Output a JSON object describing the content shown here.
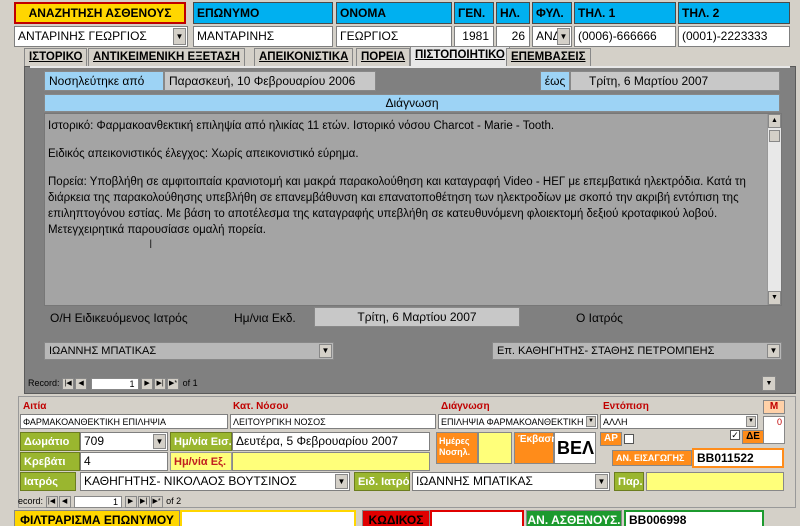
{
  "header": {
    "search_label": "ΑΝΑΖΗΤΗΣΗ ΑΣΘΕΝΟΥΣ",
    "search_value": "ΑΝΤΑΡΙΝΗΣ ΓΕΩΡΓΙΟΣ",
    "col_surname": "ΕΠΩΝΥΜΟ",
    "col_name": "ΟΝΟΜΑ",
    "col_year": "ΓΕΝ.",
    "col_age": "ΗΛ.",
    "col_sex": "ΦΥΛ.",
    "col_tel1": "ΤΗΛ. 1",
    "col_tel2": "ΤΗΛ. 2",
    "surname": "ΜΑΝΤΑΡΙΝΗΣ",
    "name": "ΓΕΩΡΓΙΟΣ",
    "year": "1981",
    "age": "26",
    "sex": "ΑΝΔΙ",
    "tel1": "(0006)-666666",
    "tel2": "(0001)-2223333"
  },
  "tabs": [
    {
      "label": "ΙΣΤΟΡΙΚΟ"
    },
    {
      "label": "ΑΝΤΙΚΕΙΜΕΝΙΚΗ ΕΞΕΤΑΣΗ"
    },
    {
      "label": "ΑΠΕΙΚΟΝΙΣΤΙΚΑ"
    },
    {
      "label": "ΠΟΡΕΙΑ"
    },
    {
      "label": "ΠΙΣΤΟΠΟΙΗΤΙΚΟ"
    },
    {
      "label": "ΕΠΕΜΒΑΣΕΙΣ"
    }
  ],
  "certificate": {
    "admitted_label": "Νοσηλεύτηκε από",
    "admitted_date": "Παρασκευή, 10 Φεβρουαρίου 2006",
    "until_label": "έως",
    "until_date": "Τρίτη, 6 Μαρτίου 2007",
    "diagnosis_title": "Διάγνωση",
    "diagnosis_p1": "Ιστορικό: Φαρμακοανθεκτική επιληψία από ηλικίας 11 ετών. Ιστορικό νόσου Charcot - Marie - Tooth.",
    "diagnosis_p2": "Ειδικός απεικονιστικός έλεγχος: Χωρίς απεικονιστικό εύρημα.",
    "diagnosis_p3": "Πορεία: Υποβλήθη σε αμφιτοιπαία κρανιοτομή και μακρά παρακολούθηση και καταγραφή Video - ΗΕΓ με επεμβατικά ηλεκτρόδια. Κατά τη διάρκεια της παρακολούθησης υπεβλήθη σε επανεμβάθυνση και επανατοποθέτηση των ηλεκτροδίων με σκοπό την ακριβή εντόπιση της επιληπτογόνου εστίας. Με βάση το αποτέλεσμα της καταγραφής υπεβλήθη σε κατευθυνόμενη φλοιεκτομή δεξιού κροταφικού λοβού. Μετεγχειρητικά παρουσίασε ομαλή πορεία.",
    "specialist_label": "Ο/Η Ειδικευόμενος Ιατρός",
    "issue_date_label": "Ημ/νια Εκδ.",
    "issue_date": "Τρίτη, 6 Μαρτίου 2007",
    "doctor_label": "Ο Ιατρός",
    "specialist_value": "ΙΩΑΝΝΗΣ ΜΠΑΤΙΚΑΣ",
    "doctor_value": "Επ. ΚΑΘΗΓΗΤΗΣ- ΣΤΑΘΗΣ ΠΕΤΡΟΜΠΕΗΣ",
    "record_label": "Record:",
    "record_num": "1",
    "record_of": "of 1"
  },
  "admission": {
    "cause_label": "Αιτία",
    "cause_value": "ΦΑΡΜΑΚΟΑΝΘΕΚΤΙΚΗ ΕΠΙΛΗΨΙΑ",
    "disease_cat_label": "Κατ. Νόσου",
    "disease_cat_value": "ΛΕΙΤΟΥΡΓΙΚΗ ΝΟΣΟΣ",
    "diagnosis_label": "Διάγνωση",
    "diagnosis_value": "ΕΠΙΛΗΨΙΑ ΦΑΡΜΑΚΟΑΝΘΕΚΤΙΚΗ",
    "location_label": "Εντόπιση",
    "location_value": "ΑΛΛΗ",
    "m_label": "Μ",
    "m_value": "0",
    "room_label": "Δωμάτιο",
    "room_value": "709",
    "entry_date_label": "Ημ/νία Εισ.",
    "entry_date_value": "Δευτέρα, 5 Φεβρουαρίου 2007",
    "bed_label": "Κρεβάτι",
    "bed_value": "4",
    "exit_date_label": "Ημ/νία Εξ.",
    "exit_date_value": "",
    "days_label": "Ημέρες Νοσηλ.",
    "outcome_label": "Έκβαση",
    "outcome_value": "ΒΕΛ",
    "ap_label": "ΑΡ",
    "de_label": "ΔΕ",
    "entry_no_label": "ΑΝ. ΕΙΣΑΓΩΓΗΣ",
    "entry_no_value": "ΒΒ011522",
    "doctor_label": "Ιατρός",
    "doctor_value": "ΚΑΘΗΓΗΤΗΣ- ΝΙΚΟΛΑΟΣ ΒΟΥΤΣΙΝΟΣ",
    "sp_doctor_label": "Ειδ. Ιατρός",
    "sp_doctor_value": "ΙΩΑΝΝΗΣ ΜΠΑΤΙΚΑΣ",
    "par_label": "Παρ.",
    "record_label": "ecord:",
    "record_num": "1",
    "record_of": "of 2"
  },
  "footer": {
    "filter_label": "ΦΙΛΤΡΑΡΙΣΜΑ ΕΠΩΝΥΜΟΥ",
    "code_label": "ΚΩΔΙΚΟΣ",
    "patient_no_label": "ΑΝ. ΑΣΘΕΝΟΥΣ.",
    "patient_no_value": "ΒΒ006998"
  },
  "colors": {
    "header_blue": "#00b0f0",
    "search_yellow": "#ffd600",
    "diagnosis_bar": "#9dd3f5",
    "olive_label": "#9ab62f",
    "orange_label": "#ff8c1a",
    "cyan_field": "#00c8f0"
  }
}
